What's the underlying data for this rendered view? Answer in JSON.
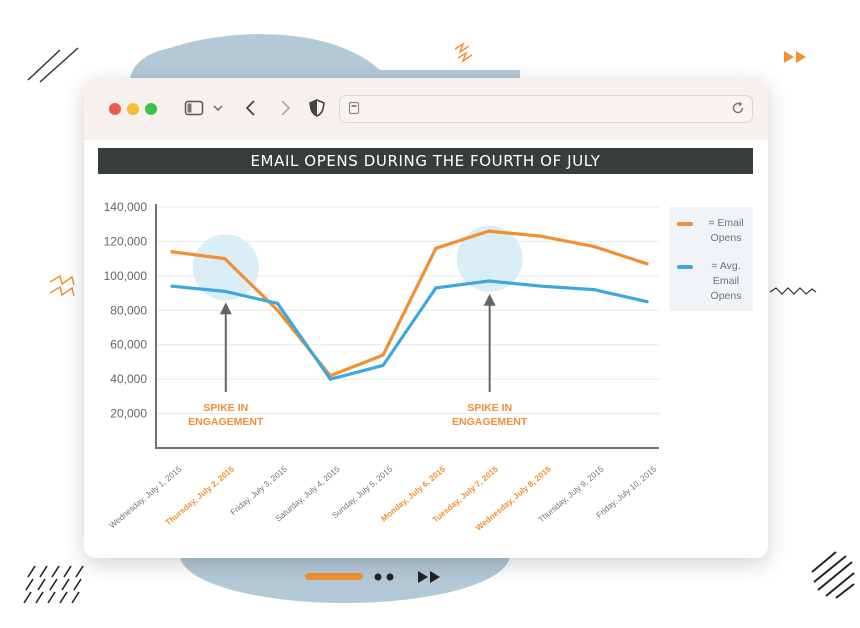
{
  "browser": {
    "window_controls": [
      "close",
      "minimize",
      "maximize"
    ],
    "toolbar_icons": [
      "sidebar-icon",
      "chevron-down-icon",
      "back-icon",
      "forward-icon",
      "shield-icon"
    ],
    "address_bar": {
      "value": "",
      "icons": [
        "page-icon",
        "reload-icon"
      ]
    }
  },
  "chart_data": {
    "type": "line",
    "title": "EMAIL OPENS DURING THE FOURTH OF JULY",
    "categories": [
      "Wednesday, July 1, 2015",
      "Thursday, July 2, 2015",
      "Friday, July 3, 2015",
      "Saturday, July 4, 2015",
      "Sunday, July 5, 2015",
      "Monday, July 6, 2015",
      "Tuesday, July 7, 2015",
      "Wednesday, July 8, 2015",
      "Thursday, July 9, 2015",
      "Friday, July 10, 2015"
    ],
    "highlighted_categories": [
      1,
      5,
      6,
      7
    ],
    "y_ticks": [
      "20,000",
      "40,000",
      "60,000",
      "80,000",
      "100,000",
      "120,000",
      "140,000"
    ],
    "ylim": [
      0,
      140000
    ],
    "grid": true,
    "series": [
      {
        "legend": "= Email Opens",
        "color": "#f28f33",
        "values": [
          114000,
          110000,
          80000,
          42000,
          54000,
          116000,
          126000,
          123000,
          117000,
          107000
        ]
      },
      {
        "legend": "= Avg. Email Opens",
        "color": "#3ea8dc",
        "values": [
          94000,
          91000,
          84000,
          40000,
          48000,
          93000,
          97000,
          94000,
          92000,
          85000
        ]
      }
    ],
    "annotations": [
      {
        "text": "SPIKE IN ENGAGEMENT",
        "category_index": 1,
        "y_value": 102000
      },
      {
        "text": "SPIKE IN ENGAGEMENT",
        "category_index": 6,
        "y_value": 107000
      }
    ],
    "legend_position": "right",
    "colors": {
      "highlight": "#f28f33",
      "axis_label": "#6a7379",
      "grid": "#e6eaec",
      "spike_circle": "#d3ebf7"
    }
  }
}
